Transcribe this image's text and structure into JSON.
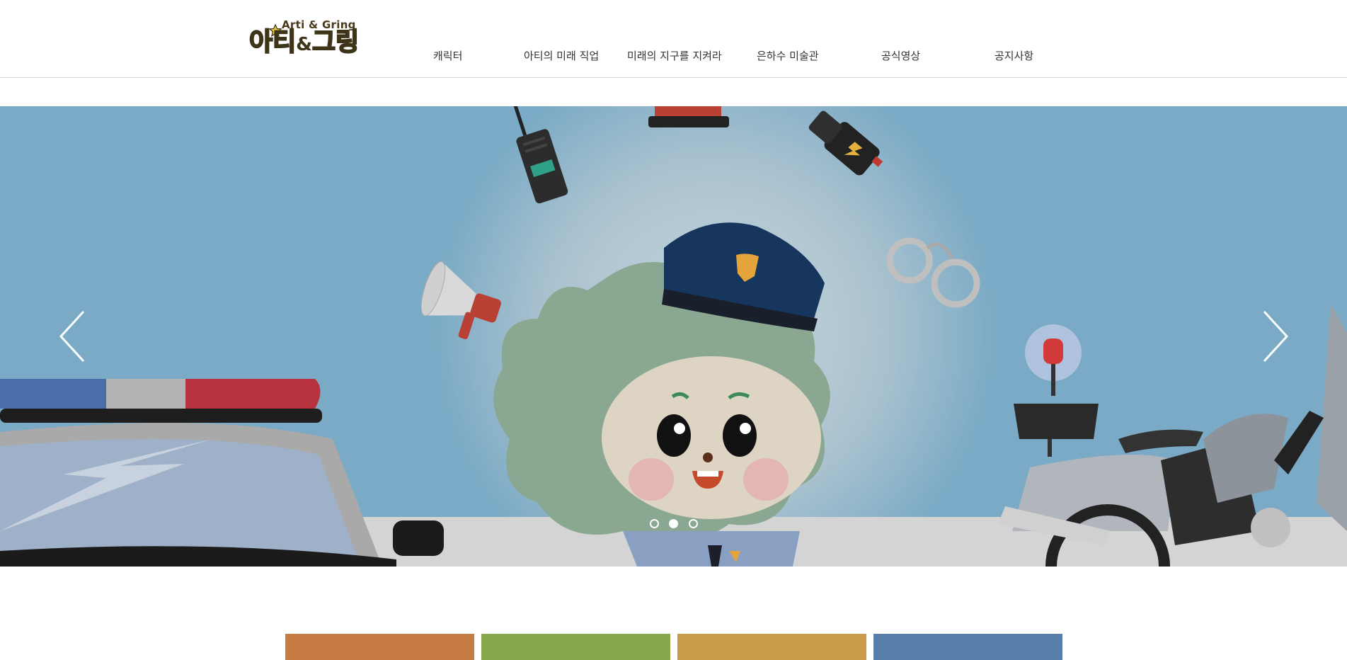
{
  "logo": {
    "sub": "Arti & Gring",
    "main_a": "아티",
    "main_amp": "&",
    "main_g": "그링"
  },
  "nav": {
    "items": [
      {
        "label": "캐릭터"
      },
      {
        "label": "아티의 미래 직업"
      },
      {
        "label": "미래의 지구를 지켜라"
      },
      {
        "label": "은하수 미술관"
      },
      {
        "label": "공식영상"
      },
      {
        "label": "공지사항"
      }
    ]
  },
  "slider": {
    "dots": 3,
    "active_dot": 2,
    "prev_icon": "chevron-left-icon",
    "next_icon": "chevron-right-icon",
    "scene_icon": "police-officer-character-illustration"
  },
  "cards": [
    {
      "color": "#c57b42"
    },
    {
      "color": "#86a84a"
    },
    {
      "color": "#c99a48"
    },
    {
      "color": "#577eab"
    }
  ],
  "colors": {
    "hero_bg": "#7aaac5",
    "header_border": "#d9d9d9",
    "nav_text": "#333333"
  }
}
